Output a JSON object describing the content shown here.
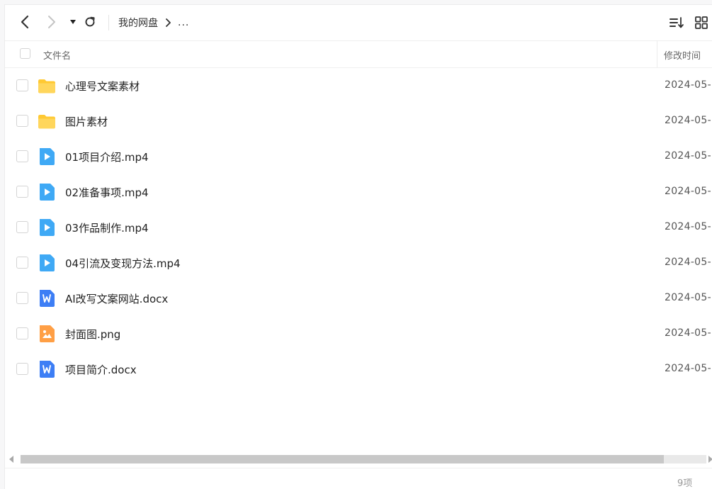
{
  "toolbar": {
    "back_icon": "chevron-left-icon",
    "forward_icon": "chevron-right-icon",
    "dropdown_icon": "caret-down-icon",
    "refresh_icon": "refresh-icon",
    "breadcrumb": {
      "root": "我的网盘",
      "more": "..."
    },
    "sort_icon": "sort-list-icon",
    "view_icon": "grid-view-icon"
  },
  "table": {
    "columns": {
      "name": "文件名",
      "modified": "修改时间"
    },
    "rows": [
      {
        "name": "心理号文案素材",
        "type": "folder",
        "modified": "2024-05-"
      },
      {
        "name": "图片素材",
        "type": "folder",
        "modified": "2024-05-"
      },
      {
        "name": "01项目介绍.mp4",
        "type": "video",
        "modified": "2024-05-"
      },
      {
        "name": "02准备事项.mp4",
        "type": "video",
        "modified": "2024-05-"
      },
      {
        "name": "03作品制作.mp4",
        "type": "video",
        "modified": "2024-05-"
      },
      {
        "name": "04引流及变现方法.mp4",
        "type": "video",
        "modified": "2024-05-"
      },
      {
        "name": "AI改写文案网站.docx",
        "type": "word",
        "modified": "2024-05-"
      },
      {
        "name": "封面图.png",
        "type": "image",
        "modified": "2024-05-"
      },
      {
        "name": "项目简介.docx",
        "type": "word",
        "modified": "2024-05-"
      }
    ]
  },
  "footer": {
    "count": "9项"
  },
  "colors": {
    "folder": "#ffc933",
    "video": "#3fa9f5",
    "word": "#3d7ef5",
    "image": "#ff9f45"
  }
}
